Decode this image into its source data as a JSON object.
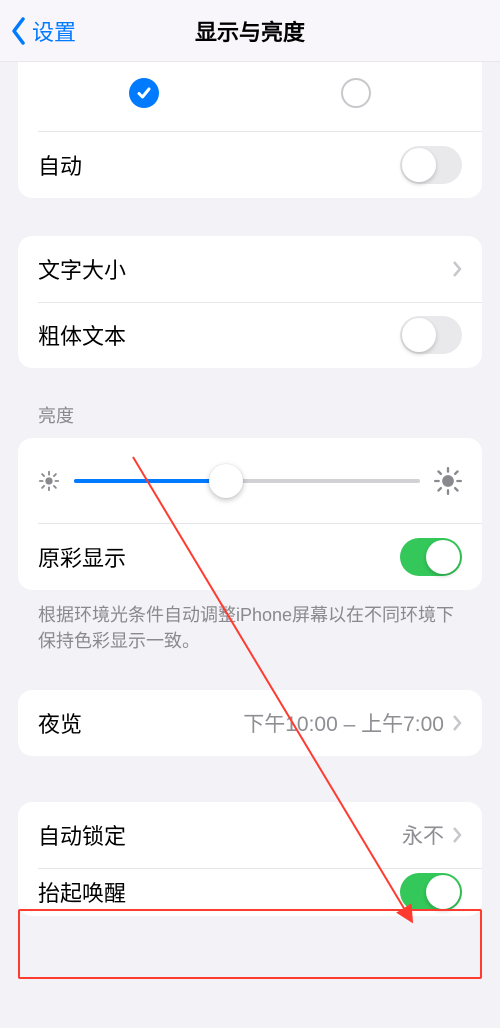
{
  "nav": {
    "back_label": "设置",
    "title": "显示与亮度"
  },
  "appearance": {
    "auto_label": "自动",
    "auto_on": false,
    "selected": "light"
  },
  "text": {
    "size_label": "文字大小",
    "bold_label": "粗体文本",
    "bold_on": false
  },
  "brightness": {
    "header": "亮度",
    "value_percent": 44,
    "true_tone_label": "原彩显示",
    "true_tone_on": true,
    "footer": "根据环境光条件自动调整iPhone屏幕以在不同环境下保持色彩显示一致。"
  },
  "night_shift": {
    "label": "夜览",
    "value": "下午10:00 – 上午7:00"
  },
  "auto_lock": {
    "label": "自动锁定",
    "value": "永不"
  },
  "raise_to_wake": {
    "label": "抬起唤醒",
    "on": true
  }
}
